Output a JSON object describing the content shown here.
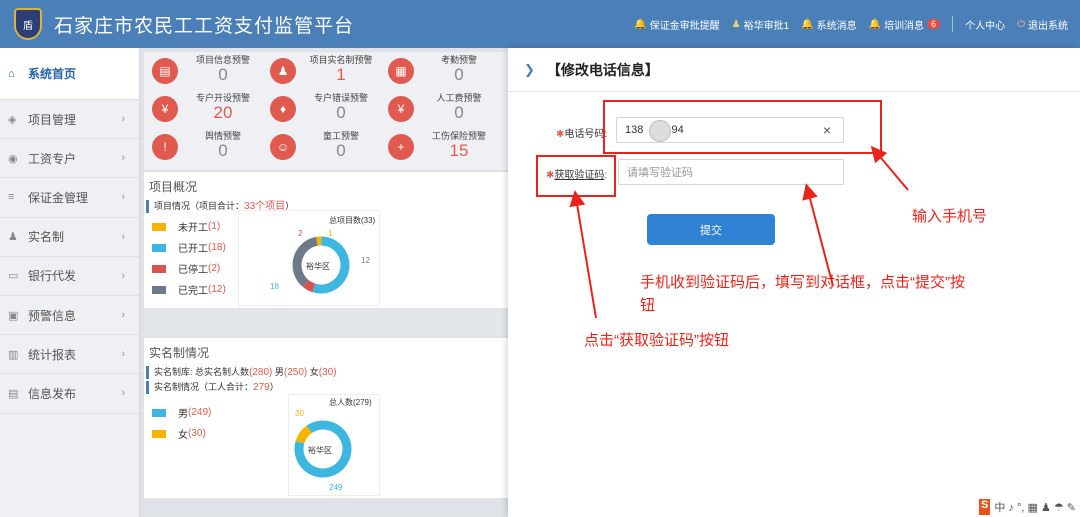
{
  "header": {
    "title": "石家庄市农民工工资支付监管平台",
    "logo_text": "盾",
    "nav": [
      {
        "label": "保证金审批提醒"
      },
      {
        "label": "裕华审批1"
      },
      {
        "label": "系统消息"
      },
      {
        "label": "培训消息",
        "badge": "6"
      }
    ],
    "personal": "个人中心",
    "logout": "退出系统"
  },
  "sidebar": {
    "items": [
      {
        "label": "系统首页",
        "icon": "home-icon",
        "glyph": "⌂"
      },
      {
        "label": "项目管理",
        "icon": "cube-icon",
        "glyph": "◈"
      },
      {
        "label": "工资专户",
        "icon": "coin-icon",
        "glyph": "◉"
      },
      {
        "label": "保证金管理",
        "icon": "list-icon",
        "glyph": "≡"
      },
      {
        "label": "实名制",
        "icon": "user-icon",
        "glyph": "♟"
      },
      {
        "label": "银行代发",
        "icon": "card-icon",
        "glyph": "▭"
      },
      {
        "label": "预警信息",
        "icon": "lock-icon",
        "glyph": "▣"
      },
      {
        "label": "统计报表",
        "icon": "bar-chart-icon",
        "glyph": "▥"
      },
      {
        "label": "信息发布",
        "icon": "doc-icon",
        "glyph": "▤"
      }
    ]
  },
  "alerts": [
    [
      {
        "label": "项目信息预警",
        "value": "0",
        "glyph": "▤",
        "icon": "document-icon",
        "red": false
      },
      {
        "label": "项目实名制预警",
        "value": "1",
        "glyph": "♟",
        "icon": "people-icon",
        "red": true
      },
      {
        "label": "考勤预警",
        "value": "0",
        "glyph": "▦",
        "icon": "calendar-icon",
        "red": false
      }
    ],
    [
      {
        "label": "专户开设预警",
        "value": "20",
        "glyph": "¥",
        "icon": "account-icon",
        "red": true
      },
      {
        "label": "专户错误预警",
        "value": "0",
        "glyph": "♦",
        "icon": "moneybag-icon",
        "red": false
      },
      {
        "label": "人工费预警",
        "value": "0",
        "glyph": "¥",
        "icon": "yen-icon",
        "red": false
      }
    ],
    [
      {
        "label": "舆情预警",
        "value": "0",
        "glyph": "!",
        "icon": "chat-icon",
        "red": false
      },
      {
        "label": "童工预警",
        "value": "0",
        "glyph": "☺",
        "icon": "child-icon",
        "red": false
      },
      {
        "label": "工伤保险预警",
        "value": "15",
        "glyph": "+",
        "icon": "medical-icon",
        "red": true
      }
    ]
  ],
  "project": {
    "section_title": "项目概况",
    "stat_prefix": "项目情况（项目合计：",
    "stat_count": "33个项目",
    "stat_suffix": "）",
    "legend": [
      {
        "label": "未开工",
        "value": "(1)",
        "color": "#f5b400"
      },
      {
        "label": "已开工",
        "value": "(18)",
        "color": "#3db6e0"
      },
      {
        "label": "已停工",
        "value": "(2)",
        "color": "#d9534f"
      },
      {
        "label": "已完工",
        "value": "(12)",
        "color": "#6c7a89"
      }
    ],
    "donut_title": "总项目数(33)",
    "donut_center": "裕华区",
    "labels": {
      "l2": "2",
      "l1": "1",
      "l12": "12",
      "l18": "18"
    }
  },
  "realname": {
    "section_title": "实名制情况",
    "line1_prefix": "实名制库: 总实名制人数",
    "line1_total": "(280)",
    "line1_male_label": " 男",
    "line1_male": "(250)",
    "line1_female_label": " 女",
    "line1_female": "(30)",
    "line2_prefix": "实名制情况（工人合计：",
    "line2_total": "279",
    "line2_suffix": "）",
    "legend": [
      {
        "label": "男",
        "value": "(249)",
        "color": "#3db6e0"
      },
      {
        "label": "女",
        "value": "(30)",
        "color": "#f5b400"
      }
    ],
    "donut_title": "总人数(279)",
    "donut_center": "裕华区",
    "labels": {
      "l30": "30",
      "l249": "249"
    }
  },
  "chart_data": [
    {
      "type": "pie",
      "title": "总项目数(33)",
      "categories": [
        "未开工",
        "已开工",
        "已停工",
        "已完工"
      ],
      "values": [
        1,
        18,
        2,
        12
      ],
      "colors": [
        "#f5b400",
        "#3db6e0",
        "#d9534f",
        "#6c7a89"
      ]
    },
    {
      "type": "pie",
      "title": "总人数(279)",
      "categories": [
        "男",
        "女"
      ],
      "values": [
        249,
        30
      ],
      "colors": [
        "#3db6e0",
        "#f5b400"
      ]
    }
  ],
  "dialog": {
    "title": "【修改电话信息】",
    "phone_label": "电话号码",
    "phone_value": "138          194",
    "code_label": "获取验证码",
    "code_placeholder": "请填写验证码",
    "submit": "提交",
    "colon": ":",
    "clear": "×"
  },
  "annotations": {
    "input_phone": "输入手机号",
    "fill_code_1": "手机收到验证码后，填写到对话框，点击“提交”按",
    "fill_code_2": "钮",
    "click_get_code": "点击“获取验证码”按钮"
  },
  "ime": {
    "logo": "S",
    "text": "中 ♪ °, ▦ ♟ ☂ ✎"
  }
}
